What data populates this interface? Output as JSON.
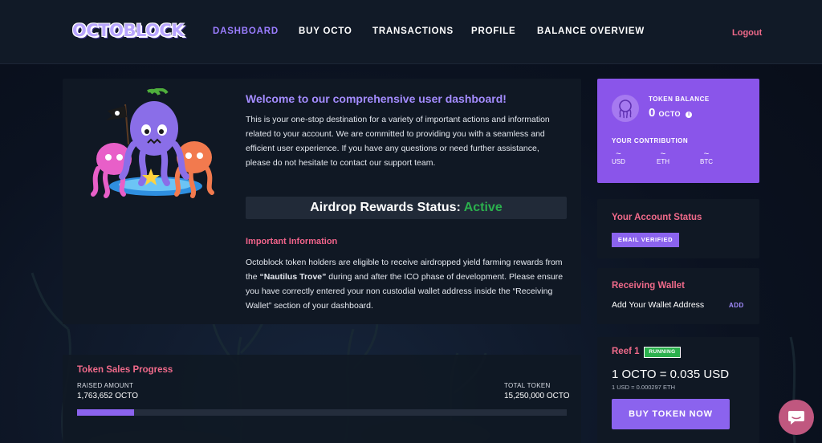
{
  "header": {
    "logo": "OCTOBLOCK",
    "nav": [
      {
        "label": "DASHBOARD",
        "active": true
      },
      {
        "label": "BUY OCTO",
        "active": false
      },
      {
        "label": "TRANSACTIONS",
        "active": false
      },
      {
        "label": "PROFILE",
        "active": false
      },
      {
        "label": "BALANCE OVERVIEW",
        "active": false
      }
    ],
    "logout": "Logout"
  },
  "welcome": {
    "title": "Welcome to our comprehensive user dashboard!",
    "text": "This is your one-stop destination for a variety of important actions and information related to your account. We are committed to providing you with a seamless and efficient user experience. If you have any questions or need further assistance, please do not hesitate to contact our support team."
  },
  "airdrop": {
    "label": "Airdrop Rewards Status:",
    "status": "Active"
  },
  "important": {
    "title": "Important Information",
    "text_before": "Octoblock token holders are eligible to receive airdropped yield farming rewards from the ",
    "highlight": "“Nautilus Trove”",
    "text_after": " during and after the ICO phase of development. Please ensure you have correctly entered your non custodial wallet address inside the “Receiving Wallet” section of your dashboard."
  },
  "sales": {
    "title": "Token Sales Progress",
    "raised_label": "RAISED AMOUNT",
    "raised_value": "1,763,652 OCTO",
    "total_label": "TOTAL TOKEN",
    "total_value": "15,250,000 OCTO",
    "progress_fraction": 0.1157
  },
  "balance": {
    "label": "TOKEN BALANCE",
    "value": "0",
    "unit": "OCTO",
    "info_icon": "info-icon",
    "contribution_label": "YOUR CONTRIBUTION",
    "contributions": [
      {
        "value": "~",
        "currency": "USD"
      },
      {
        "value": "~",
        "currency": "ETH"
      },
      {
        "value": "~",
        "currency": "BTC"
      }
    ]
  },
  "account_status": {
    "title": "Your Account Status",
    "badge": "EMAIL VERIFIED"
  },
  "wallet": {
    "title": "Receiving Wallet",
    "label": "Add Your Wallet Address",
    "action": "ADD"
  },
  "reef": {
    "title": "Reef 1",
    "status": "RUNNING",
    "price": "1 OCTO = 0.035 USD",
    "sub_price": "1 USD = 0.000297 ETH",
    "buy_label": "BUY TOKEN NOW"
  },
  "colors": {
    "accent": "#8b63ee",
    "pink": "#f06a8a",
    "green": "#2bb04d",
    "background": "#0b1220"
  },
  "icons": {
    "chat": "chat-bubble-icon",
    "token": "octopus-icon"
  }
}
